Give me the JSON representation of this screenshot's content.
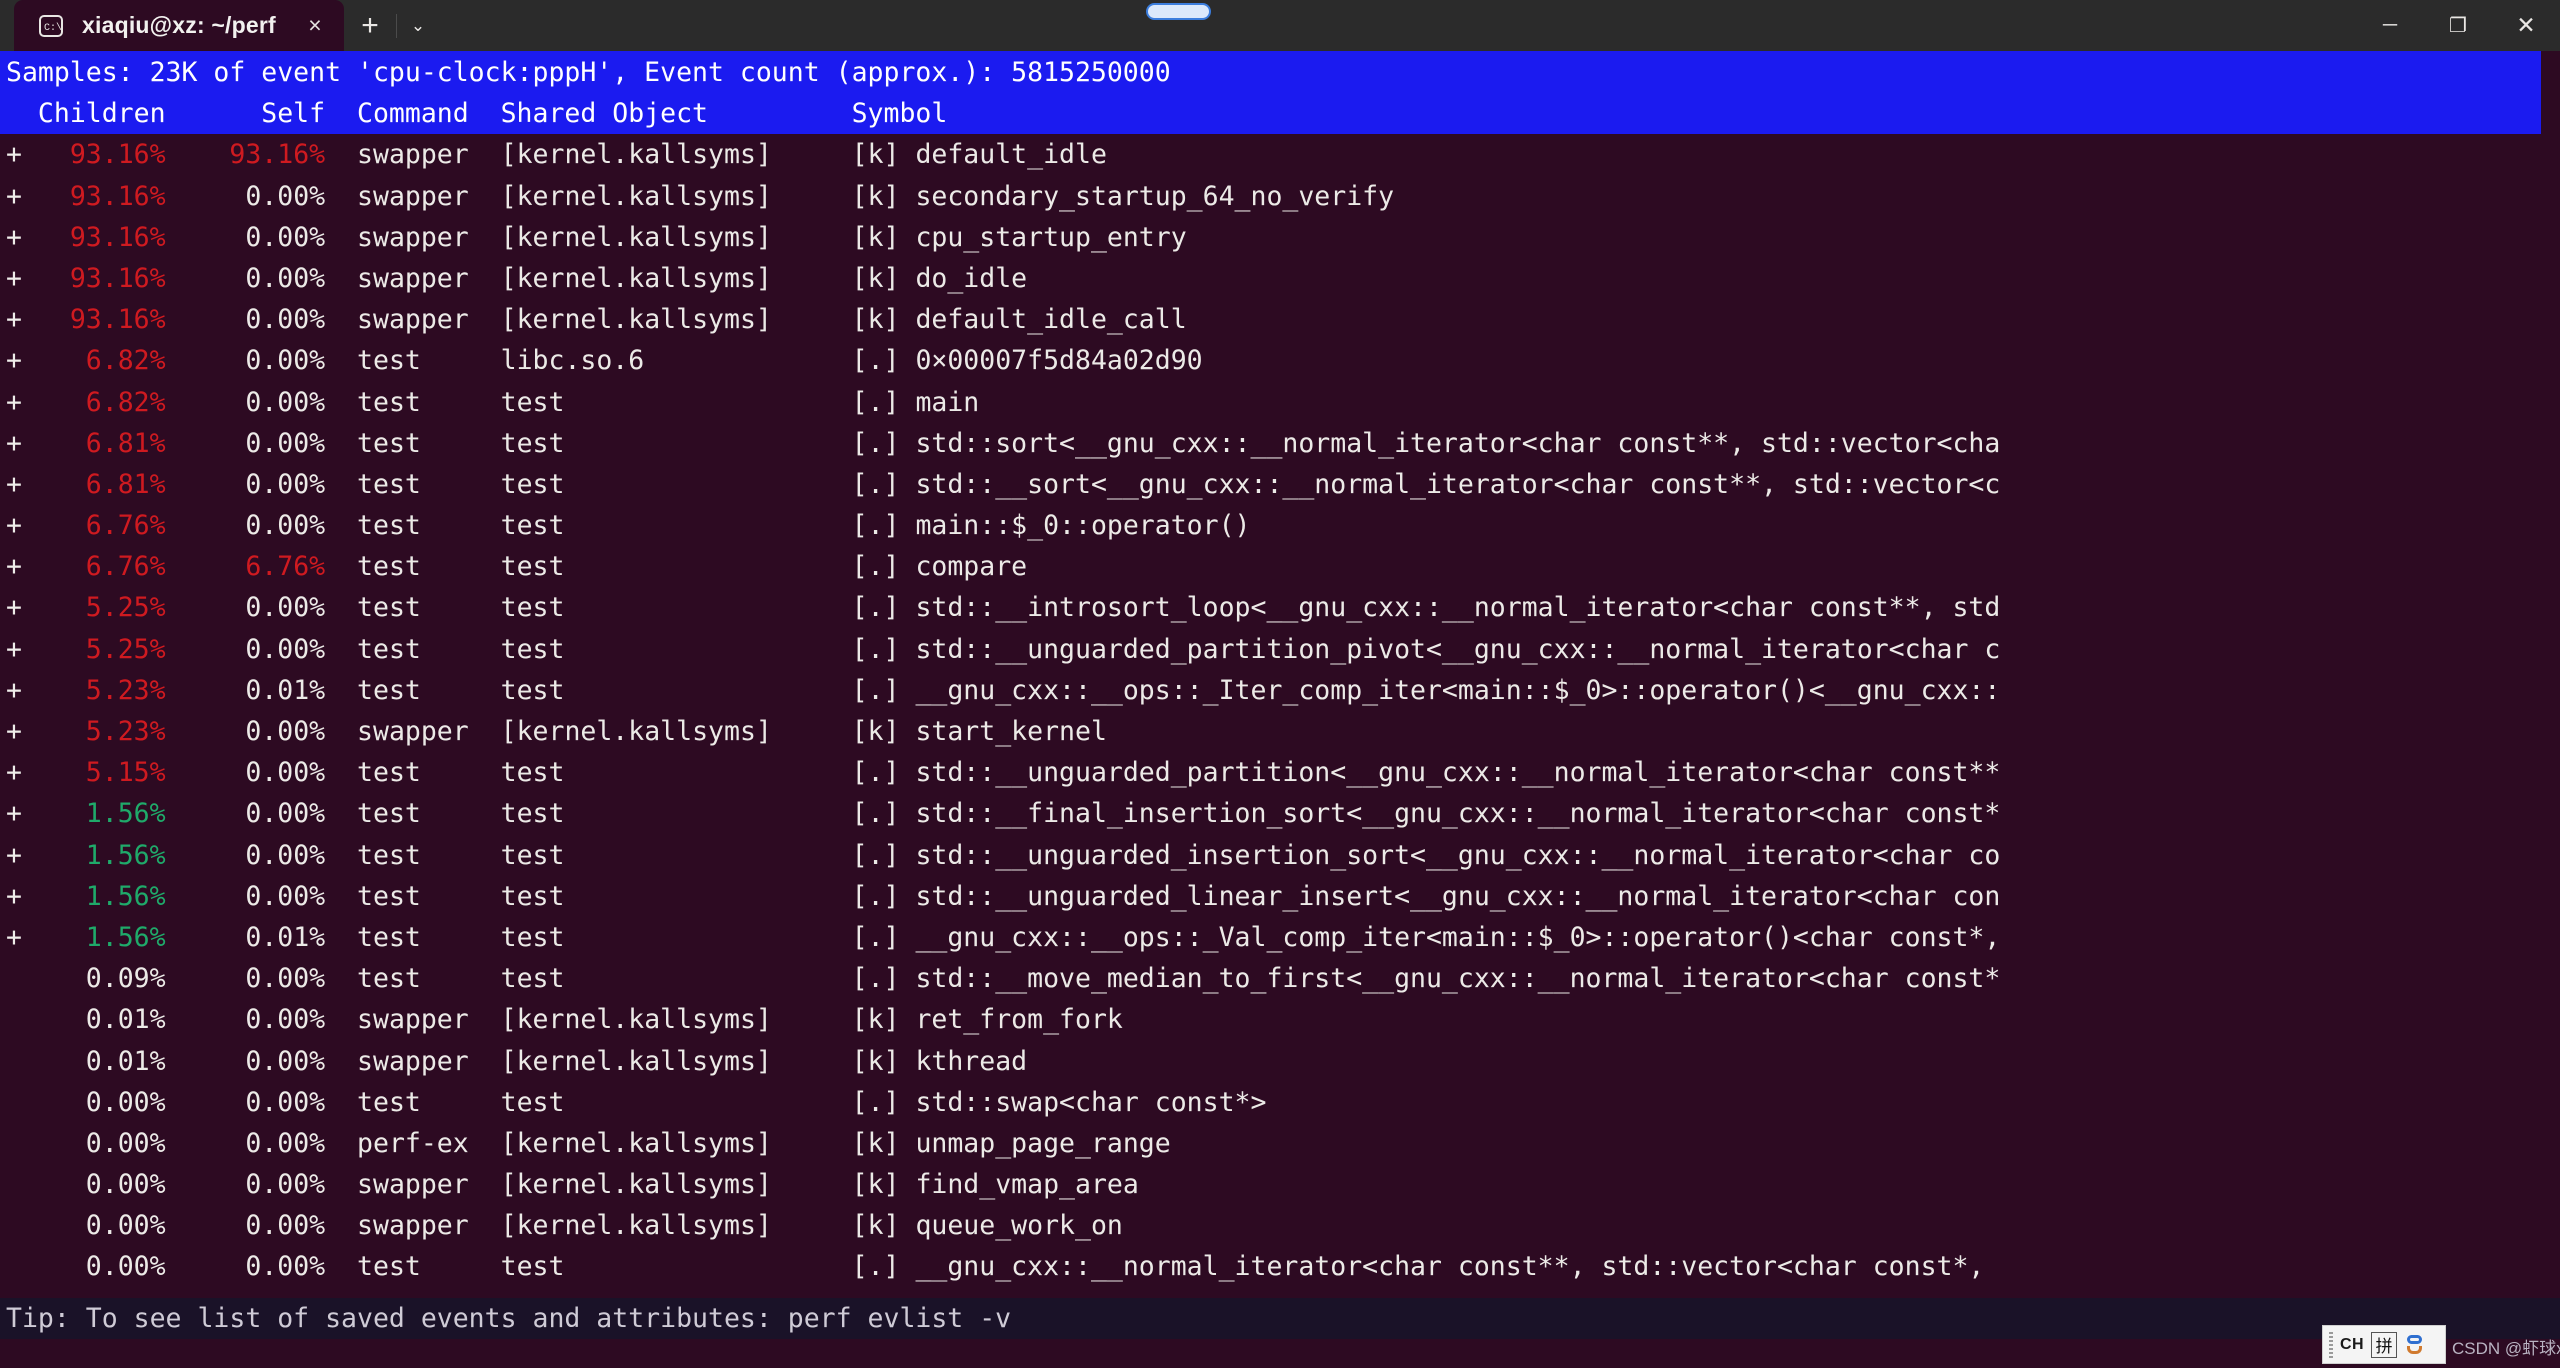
{
  "window": {
    "tab_title": "xiaqiu@xz: ~/perf",
    "tab_icon": "terminal-icon",
    "close_label": "×",
    "new_tab_label": "+",
    "tab_menu_label": "⌄",
    "minimize_label": "─",
    "maximize_label": "❐",
    "close_window_label": "✕"
  },
  "header": {
    "samples_line": "Samples: 23K of event 'cpu-clock:pppH', Event count (approx.): 5815250000",
    "columns_line": "  Children      Self  Command  Shared Object         Symbol",
    "columns": [
      "Children",
      "Self",
      "Command",
      "Shared Object",
      "Symbol"
    ],
    "bg_color": "#1b1bf0",
    "fg_color": "#ffffff"
  },
  "colors": {
    "terminal_bg": "#2d0a22",
    "titlebar_bg": "#2b2b2b",
    "red": "#cf1a20",
    "green": "#1faa6a",
    "white": "#eceae7",
    "tipbar_bg": "#1a1228"
  },
  "rows": [
    {
      "expand": "+",
      "children": "93.16%",
      "children_color": "red",
      "self": "93.16%",
      "self_color": "red",
      "command": "swapper",
      "dso": "[kernel.kallsyms]",
      "symbol": "[k] default_idle"
    },
    {
      "expand": "+",
      "children": "93.16%",
      "children_color": "red",
      "self": "0.00%",
      "self_color": "white",
      "command": "swapper",
      "dso": "[kernel.kallsyms]",
      "symbol": "[k] secondary_startup_64_no_verify"
    },
    {
      "expand": "+",
      "children": "93.16%",
      "children_color": "red",
      "self": "0.00%",
      "self_color": "white",
      "command": "swapper",
      "dso": "[kernel.kallsyms]",
      "symbol": "[k] cpu_startup_entry"
    },
    {
      "expand": "+",
      "children": "93.16%",
      "children_color": "red",
      "self": "0.00%",
      "self_color": "white",
      "command": "swapper",
      "dso": "[kernel.kallsyms]",
      "symbol": "[k] do_idle"
    },
    {
      "expand": "+",
      "children": "93.16%",
      "children_color": "red",
      "self": "0.00%",
      "self_color": "white",
      "command": "swapper",
      "dso": "[kernel.kallsyms]",
      "symbol": "[k] default_idle_call"
    },
    {
      "expand": "+",
      "children": "6.82%",
      "children_color": "red",
      "self": "0.00%",
      "self_color": "white",
      "command": "test",
      "dso": "libc.so.6",
      "symbol": "[.] 0×00007f5d84a02d90"
    },
    {
      "expand": "+",
      "children": "6.82%",
      "children_color": "red",
      "self": "0.00%",
      "self_color": "white",
      "command": "test",
      "dso": "test",
      "symbol": "[.] main"
    },
    {
      "expand": "+",
      "children": "6.81%",
      "children_color": "red",
      "self": "0.00%",
      "self_color": "white",
      "command": "test",
      "dso": "test",
      "symbol": "[.] std::sort<__gnu_cxx::__normal_iterator<char const**, std::vector<cha"
    },
    {
      "expand": "+",
      "children": "6.81%",
      "children_color": "red",
      "self": "0.00%",
      "self_color": "white",
      "command": "test",
      "dso": "test",
      "symbol": "[.] std::__sort<__gnu_cxx::__normal_iterator<char const**, std::vector<c"
    },
    {
      "expand": "+",
      "children": "6.76%",
      "children_color": "red",
      "self": "0.00%",
      "self_color": "white",
      "command": "test",
      "dso": "test",
      "symbol": "[.] main::$_0::operator()"
    },
    {
      "expand": "+",
      "children": "6.76%",
      "children_color": "red",
      "self": "6.76%",
      "self_color": "red",
      "command": "test",
      "dso": "test",
      "symbol": "[.] compare"
    },
    {
      "expand": "+",
      "children": "5.25%",
      "children_color": "red",
      "self": "0.00%",
      "self_color": "white",
      "command": "test",
      "dso": "test",
      "symbol": "[.] std::__introsort_loop<__gnu_cxx::__normal_iterator<char const**, std"
    },
    {
      "expand": "+",
      "children": "5.25%",
      "children_color": "red",
      "self": "0.00%",
      "self_color": "white",
      "command": "test",
      "dso": "test",
      "symbol": "[.] std::__unguarded_partition_pivot<__gnu_cxx::__normal_iterator<char c"
    },
    {
      "expand": "+",
      "children": "5.23%",
      "children_color": "red",
      "self": "0.01%",
      "self_color": "white",
      "command": "test",
      "dso": "test",
      "symbol": "[.] __gnu_cxx::__ops::_Iter_comp_iter<main::$_0>::operator()<__gnu_cxx::"
    },
    {
      "expand": "+",
      "children": "5.23%",
      "children_color": "red",
      "self": "0.00%",
      "self_color": "white",
      "command": "swapper",
      "dso": "[kernel.kallsyms]",
      "symbol": "[k] start_kernel"
    },
    {
      "expand": "+",
      "children": "5.15%",
      "children_color": "red",
      "self": "0.00%",
      "self_color": "white",
      "command": "test",
      "dso": "test",
      "symbol": "[.] std::__unguarded_partition<__gnu_cxx::__normal_iterator<char const**"
    },
    {
      "expand": "+",
      "children": "1.56%",
      "children_color": "green",
      "self": "0.00%",
      "self_color": "white",
      "command": "test",
      "dso": "test",
      "symbol": "[.] std::__final_insertion_sort<__gnu_cxx::__normal_iterator<char const*"
    },
    {
      "expand": "+",
      "children": "1.56%",
      "children_color": "green",
      "self": "0.00%",
      "self_color": "white",
      "command": "test",
      "dso": "test",
      "symbol": "[.] std::__unguarded_insertion_sort<__gnu_cxx::__normal_iterator<char co"
    },
    {
      "expand": "+",
      "children": "1.56%",
      "children_color": "green",
      "self": "0.00%",
      "self_color": "white",
      "command": "test",
      "dso": "test",
      "symbol": "[.] std::__unguarded_linear_insert<__gnu_cxx::__normal_iterator<char con"
    },
    {
      "expand": "+",
      "children": "1.56%",
      "children_color": "green",
      "self": "0.01%",
      "self_color": "white",
      "command": "test",
      "dso": "test",
      "symbol": "[.] __gnu_cxx::__ops::_Val_comp_iter<main::$_0>::operator()<char const*,"
    },
    {
      "expand": " ",
      "children": "0.09%",
      "children_color": "white",
      "self": "0.00%",
      "self_color": "white",
      "command": "test",
      "dso": "test",
      "symbol": "[.] std::__move_median_to_first<__gnu_cxx::__normal_iterator<char const*"
    },
    {
      "expand": " ",
      "children": "0.01%",
      "children_color": "white",
      "self": "0.00%",
      "self_color": "white",
      "command": "swapper",
      "dso": "[kernel.kallsyms]",
      "symbol": "[k] ret_from_fork"
    },
    {
      "expand": " ",
      "children": "0.01%",
      "children_color": "white",
      "self": "0.00%",
      "self_color": "white",
      "command": "swapper",
      "dso": "[kernel.kallsyms]",
      "symbol": "[k] kthread"
    },
    {
      "expand": " ",
      "children": "0.00%",
      "children_color": "white",
      "self": "0.00%",
      "self_color": "white",
      "command": "test",
      "dso": "test",
      "symbol": "[.] std::swap<char const*>"
    },
    {
      "expand": " ",
      "children": "0.00%",
      "children_color": "white",
      "self": "0.00%",
      "self_color": "white",
      "command": "perf-ex",
      "dso": "[kernel.kallsyms]",
      "symbol": "[k] unmap_page_range"
    },
    {
      "expand": " ",
      "children": "0.00%",
      "children_color": "white",
      "self": "0.00%",
      "self_color": "white",
      "command": "swapper",
      "dso": "[kernel.kallsyms]",
      "symbol": "[k] find_vmap_area"
    },
    {
      "expand": " ",
      "children": "0.00%",
      "children_color": "white",
      "self": "0.00%",
      "self_color": "white",
      "command": "swapper",
      "dso": "[kernel.kallsyms]",
      "symbol": "[k] queue_work_on"
    },
    {
      "expand": " ",
      "children": "0.00%",
      "children_color": "white",
      "self": "0.00%",
      "self_color": "white",
      "command": "test",
      "dso": "test",
      "symbol": "[.] __gnu_cxx::__normal_iterator<char const**, std::vector<char const*,"
    }
  ],
  "tip": {
    "text": "Tip: To see list of saved events and attributes: perf evlist -v"
  },
  "taskbar": {
    "ime_lang": "CH",
    "ime_mode": "拼",
    "ime_shape_icon": "ime-shape-icon",
    "watermark": "CSDN @虾球xz"
  }
}
